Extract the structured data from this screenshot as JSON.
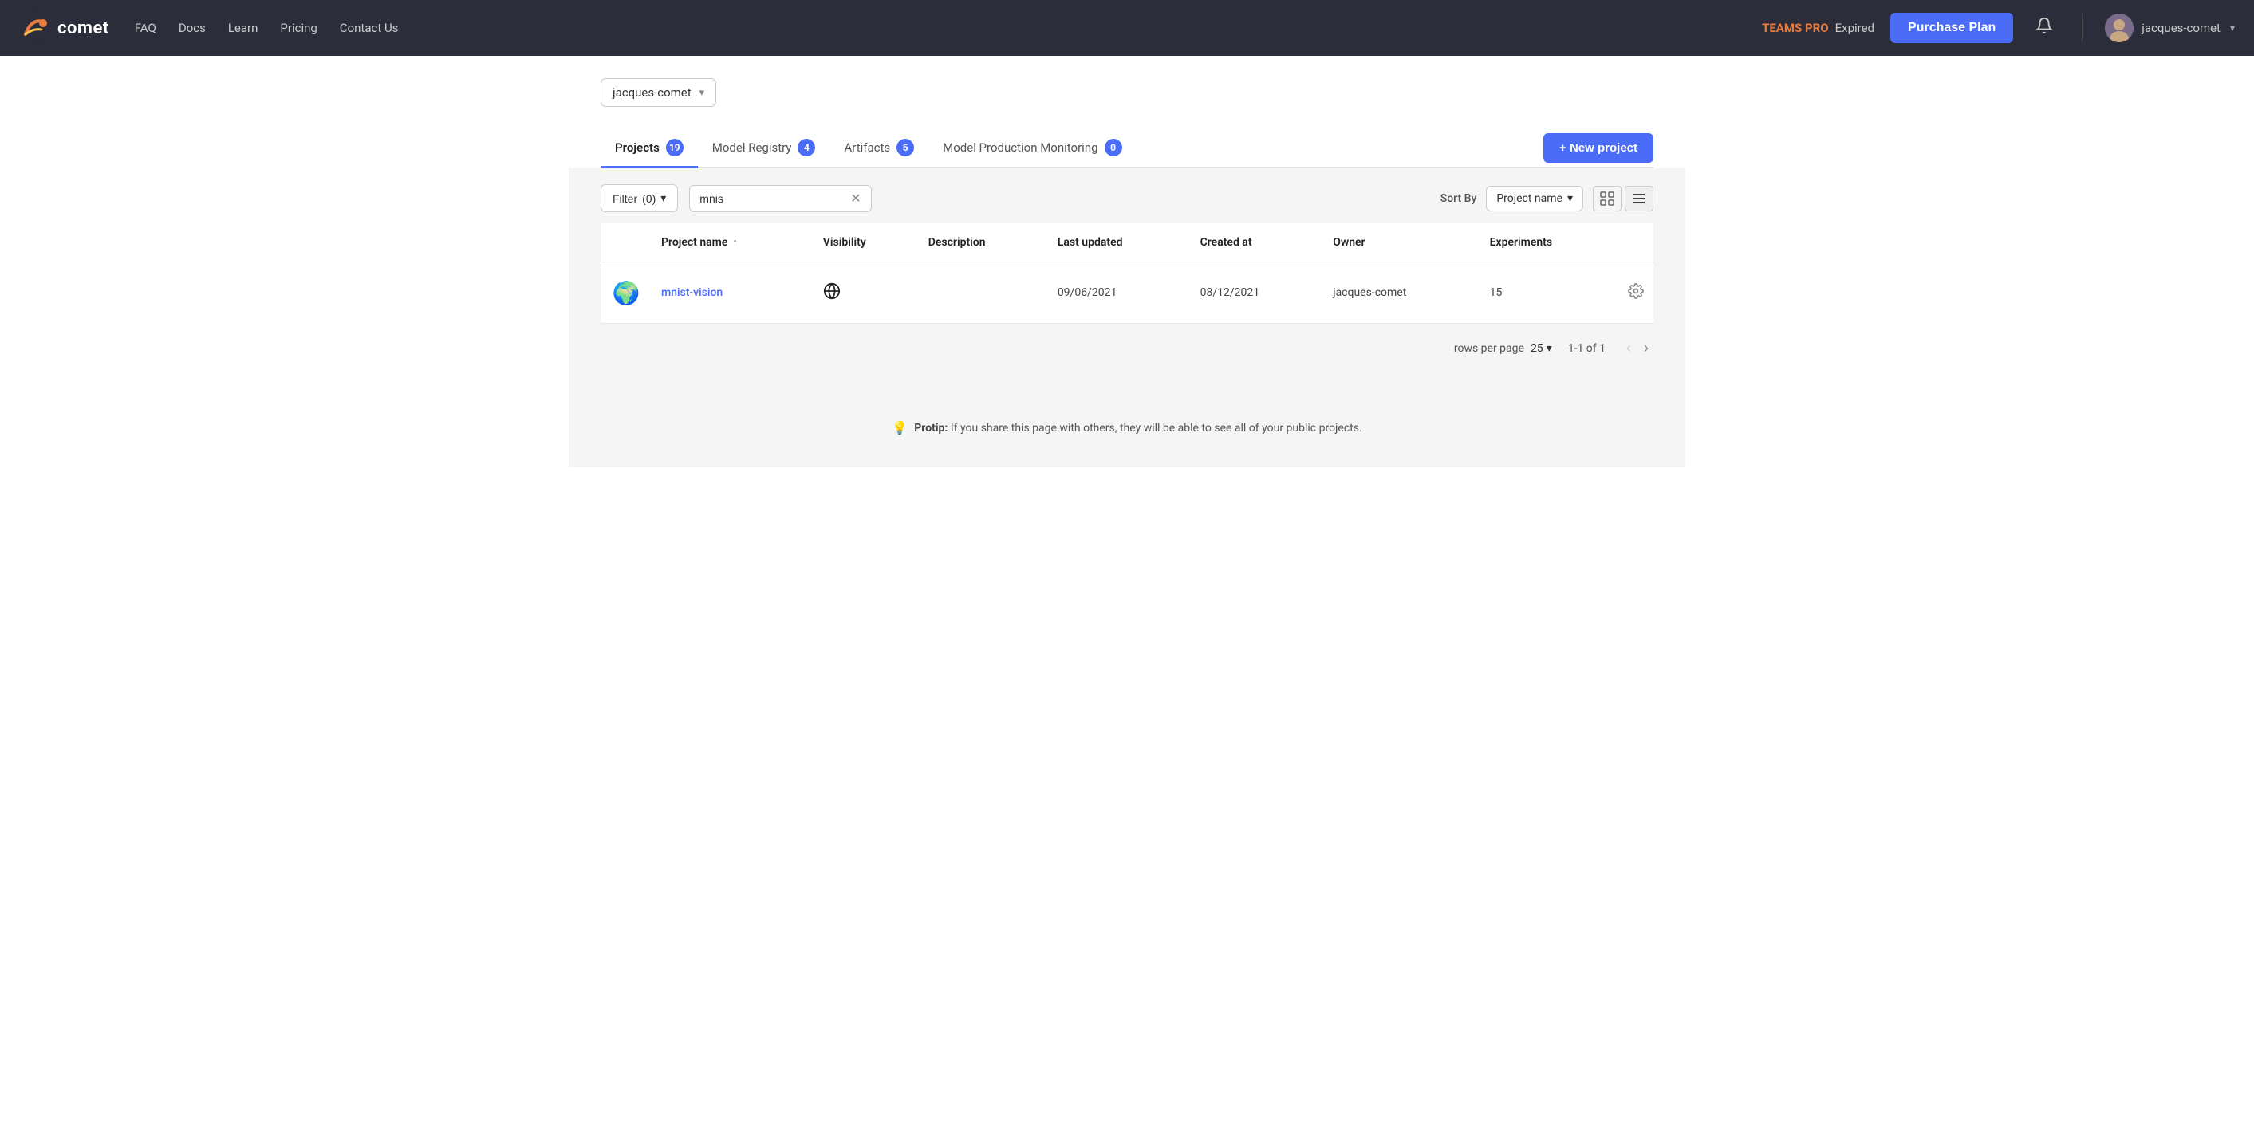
{
  "navbar": {
    "logo_text": "comet",
    "links": [
      {
        "label": "FAQ",
        "href": "#"
      },
      {
        "label": "Docs",
        "href": "#"
      },
      {
        "label": "Learn",
        "href": "#"
      },
      {
        "label": "Pricing",
        "href": "#"
      },
      {
        "label": "Contact Us",
        "href": "#"
      }
    ],
    "teams_pro_label": "TEAMS PRO",
    "expired_label": "Expired",
    "purchase_btn": "Purchase Plan",
    "user_name": "jacques-comet"
  },
  "workspace": {
    "name": "jacques-comet",
    "dropdown_label": "jacques-comet"
  },
  "tabs": [
    {
      "label": "Projects",
      "badge": "19",
      "active": true
    },
    {
      "label": "Model Registry",
      "badge": "4",
      "active": false
    },
    {
      "label": "Artifacts",
      "badge": "5",
      "active": false
    },
    {
      "label": "Model Production Monitoring",
      "badge": "0",
      "active": false
    }
  ],
  "new_project_btn": "+ New project",
  "filter": {
    "filter_label": "Filter",
    "filter_count": "(0)",
    "search_value": "mnis",
    "sort_by_label": "Sort By",
    "sort_value": "Project name"
  },
  "table": {
    "columns": [
      "Project name",
      "Visibility",
      "Description",
      "Last updated",
      "Created at",
      "Owner",
      "Experiments"
    ],
    "rows": [
      {
        "icon": "🌍",
        "name": "mnist-vision",
        "visibility": "public",
        "description": "",
        "last_updated": "09/06/2021",
        "created_at": "08/12/2021",
        "owner": "jacques-comet",
        "experiments": "15"
      }
    ]
  },
  "pagination": {
    "rows_per_page_label": "rows per page",
    "rows_per_page_value": "25",
    "page_info": "1-1 of 1"
  },
  "protip": {
    "icon": "💡",
    "bold": "Protip:",
    "text": " If you share this page with others, they will be able to see all of your public projects."
  }
}
